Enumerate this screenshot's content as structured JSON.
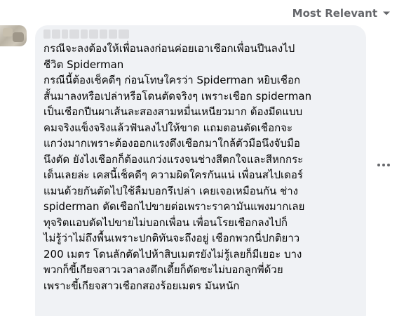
{
  "sort": {
    "label": "Most Relevant",
    "icon": "caret-down-icon"
  },
  "comment": {
    "more_icon": "more-options-icon",
    "lines": [
      "กรณีจะลงต้องให้เพื่อนลงก่อนค่อยเอาเชือกเพื่อนปีนลงไป",
      "ชีวิต Spiderman",
      "กรณีนี้ต้องเช็คดีๆ ก่อนโทษใครว่า Spiderman หยิบเชือก",
      "สั้นมาลงหรือเปล่าหรือโดนตัดจริงๆ เพราะเชือก spiderman",
      "เป็นเชือกปีนผาเส้นละสองสามหมื่นเหนียวมาก ต้องมีดแบบ",
      "คมจริงแข็งจริงแล้วฟันลงไปให้ขาด แถมตอนตัดเชือกจะ",
      "แกว่งมากเพราะต้องออกแรงดึงเชือกมาใกล้ตัวมือนึงจับมือ",
      "นึงตัด ยังไงเชือกก็ต้องแกว่งแรงจนช่างสีตกใจและสีหกกระ",
      "เด็นเลยล่ะ เคสนี้เช็คดีๆ ความผิดใครกันแน่ เพื่อนสไปเดอร์",
      "แมนด้วยกันตัดไปใช้ลืมบอกรึเปล่า เคยเจอเหมือนกัน ช่าง",
      "spiderman ตัดเชือกไปขายต่อเพราะราคามันแพงมากเลย",
      "ทุจริตแอบตัดไปขายไม่บอกเพื่อน เพื่อนโรยเชือกลงไปก็",
      "ไม่รู้ว่าไม่ถึงพื้นเพราะปกติทันจะถึงอยู่ เชือกพวกนี่ปกติยาว",
      "200 เมตร โดนลักตัดไปห้าสิบเมตรยังไม่รู้เลยก็มีเยอะ บาง",
      "พวกก็ขี้เกียจสาวเวลาลงตึกเตี้ยก็ตัดซะไม่บอกลูกพี่ด้วย",
      "เพราะขี้เกียจสาวเชือกสองร้อยเมตร มันหนัก"
    ]
  }
}
